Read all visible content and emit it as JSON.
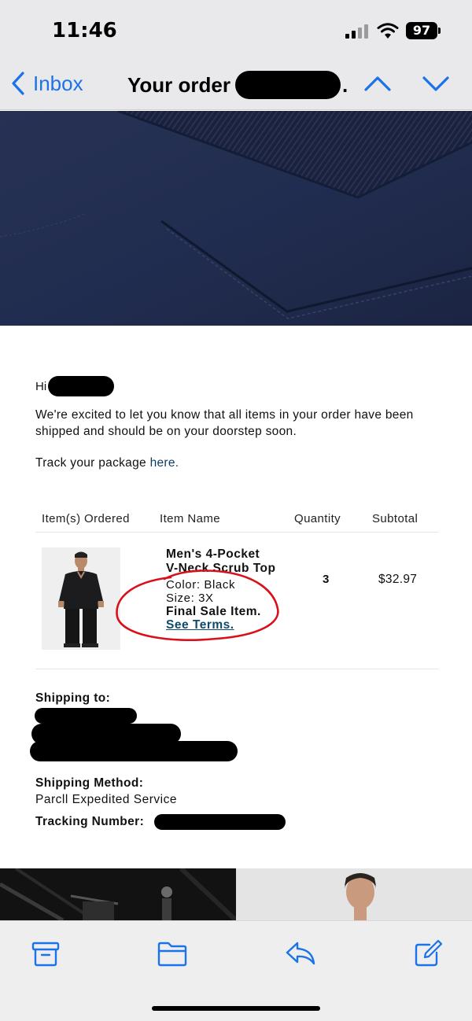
{
  "status_bar": {
    "time": "11:46",
    "battery": "97"
  },
  "nav": {
    "back_label": "Inbox",
    "title": "Your order",
    "title_suffix": "."
  },
  "email": {
    "greeting": "Hi",
    "intro": "We're excited to let you know that all items in your order have been shipped and should be on your doorstep soon.",
    "track_prefix": "Track your package ",
    "track_link": "here."
  },
  "order_table": {
    "headers": [
      "Item(s) Ordered",
      "Item Name",
      "Quantity",
      "Subtotal"
    ],
    "item": {
      "name_line1": "Men's 4-Pocket",
      "name_line2": "V-Neck Scrub Top",
      "color": "Color: Black",
      "size": "Size: 3X",
      "final_sale": "Final Sale Item.",
      "terms_link": "See Terms.",
      "quantity": "3",
      "subtotal": "$32.97"
    }
  },
  "shipping": {
    "to_label": "Shipping to:",
    "method_label": "Shipping Method:",
    "method_value": "Parcll Expedited Service",
    "tracking_label": "Tracking Number:"
  },
  "colors": {
    "ios_blue": "#1a73e8",
    "link": "#0c3b5f",
    "annotation_red": "#d9101a",
    "hero_navy": "#252f4e"
  },
  "icons": {
    "toolbar": [
      "archive-icon",
      "folder-icon",
      "reply-icon",
      "compose-icon"
    ]
  }
}
